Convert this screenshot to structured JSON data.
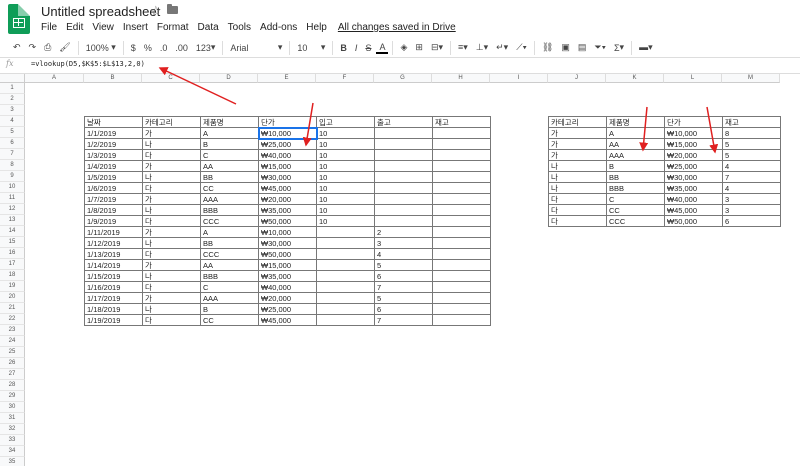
{
  "header": {
    "title": "Untitled spreadsheet",
    "star_glyph": "☆",
    "menus": [
      "File",
      "Edit",
      "View",
      "Insert",
      "Format",
      "Data",
      "Tools",
      "Add-ons",
      "Help"
    ],
    "saved_status": "All changes saved in Drive"
  },
  "toolbar": {
    "zoom": "100%",
    "currency": "$",
    "percent": "%",
    "dec_less": ".0",
    "dec_more": ".00",
    "format_more": "123",
    "font": "Arial",
    "font_size": "10",
    "bold": "B",
    "italic": "I",
    "strike": "S",
    "text_color": "A",
    "sigma": "Σ"
  },
  "formula_bar": {
    "fx": "fx",
    "formula": "=vlookup(D5,$K$5:$L$13,2,0)"
  },
  "columns": [
    "A",
    "B",
    "C",
    "D",
    "E",
    "F",
    "G",
    "H",
    "I",
    "J",
    "K",
    "L",
    "M"
  ],
  "rows": [
    "1",
    "2",
    "3",
    "4",
    "5",
    "6",
    "7",
    "8",
    "9",
    "10",
    "11",
    "12",
    "13",
    "14",
    "15",
    "16",
    "17",
    "18",
    "19",
    "20",
    "21",
    "22",
    "23",
    "24",
    "25",
    "26",
    "27",
    "28",
    "29",
    "30",
    "31",
    "32",
    "33",
    "34",
    "35"
  ],
  "left_table": {
    "headers": [
      "날짜",
      "카테고리",
      "제품명",
      "단가",
      "입고",
      "출고",
      "재고"
    ],
    "rows": [
      [
        "1/1/2019",
        "가",
        "A",
        "₩10,000",
        "10",
        "",
        ""
      ],
      [
        "1/2/2019",
        "나",
        "B",
        "₩25,000",
        "10",
        "",
        ""
      ],
      [
        "1/3/2019",
        "다",
        "C",
        "₩40,000",
        "10",
        "",
        ""
      ],
      [
        "1/4/2019",
        "가",
        "AA",
        "₩15,000",
        "10",
        "",
        ""
      ],
      [
        "1/5/2019",
        "나",
        "BB",
        "₩30,000",
        "10",
        "",
        ""
      ],
      [
        "1/6/2019",
        "다",
        "CC",
        "₩45,000",
        "10",
        "",
        ""
      ],
      [
        "1/7/2019",
        "가",
        "AAA",
        "₩20,000",
        "10",
        "",
        ""
      ],
      [
        "1/8/2019",
        "나",
        "BBB",
        "₩35,000",
        "10",
        "",
        ""
      ],
      [
        "1/9/2019",
        "다",
        "CCC",
        "₩50,000",
        "10",
        "",
        ""
      ],
      [
        "1/11/2019",
        "가",
        "A",
        "₩10,000",
        "",
        "2",
        ""
      ],
      [
        "1/12/2019",
        "나",
        "BB",
        "₩30,000",
        "",
        "3",
        ""
      ],
      [
        "1/13/2019",
        "다",
        "CCC",
        "₩50,000",
        "",
        "4",
        ""
      ],
      [
        "1/14/2019",
        "가",
        "AA",
        "₩15,000",
        "",
        "5",
        ""
      ],
      [
        "1/15/2019",
        "나",
        "BBB",
        "₩35,000",
        "",
        "6",
        ""
      ],
      [
        "1/16/2019",
        "다",
        "C",
        "₩40,000",
        "",
        "7",
        ""
      ],
      [
        "1/17/2019",
        "가",
        "AAA",
        "₩20,000",
        "",
        "5",
        ""
      ],
      [
        "1/18/2019",
        "나",
        "B",
        "₩25,000",
        "",
        "6",
        ""
      ],
      [
        "1/19/2019",
        "다",
        "CC",
        "₩45,000",
        "",
        "7",
        ""
      ]
    ]
  },
  "right_table": {
    "headers": [
      "카테고리",
      "제품명",
      "단가",
      "재고"
    ],
    "rows": [
      [
        "가",
        "A",
        "₩10,000",
        "8"
      ],
      [
        "가",
        "AA",
        "₩15,000",
        "5"
      ],
      [
        "가",
        "AAA",
        "₩20,000",
        "5"
      ],
      [
        "나",
        "B",
        "₩25,000",
        "4"
      ],
      [
        "나",
        "BB",
        "₩30,000",
        "7"
      ],
      [
        "나",
        "BBB",
        "₩35,000",
        "4"
      ],
      [
        "다",
        "C",
        "₩40,000",
        "3"
      ],
      [
        "다",
        "CC",
        "₩45,000",
        "3"
      ],
      [
        "다",
        "CCC",
        "₩50,000",
        "6"
      ]
    ]
  },
  "colors": {
    "arrow": "#e02020",
    "selection": "#1a73e8",
    "logo": "#0f9d58"
  }
}
